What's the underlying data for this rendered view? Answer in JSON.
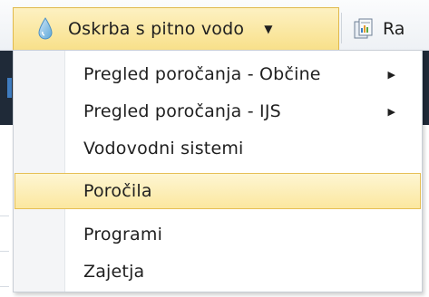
{
  "menubar": {
    "active_menu": {
      "label": "Oskrba s pitno vodo",
      "icon": "water-drop-icon"
    },
    "next_menu": {
      "label": "Ra",
      "icon": "report-document-icon"
    }
  },
  "dropdown": {
    "items": [
      {
        "label": "Pregled poročanja - Občine",
        "has_submenu": true
      },
      {
        "label": "Pregled poročanja - IJS",
        "has_submenu": true
      },
      {
        "label": "Vodovodni sistemi",
        "has_submenu": false
      },
      {
        "label": "Poročila",
        "has_submenu": false,
        "highlighted": true
      },
      {
        "label": "Programi",
        "has_submenu": false
      },
      {
        "label": "Zajetja",
        "has_submenu": false
      }
    ]
  },
  "colors": {
    "highlight_top": "#fef6d3",
    "highlight_bottom": "#fbe79f",
    "highlight_border": "#e6bf55",
    "page_dark": "#1f2a38"
  }
}
